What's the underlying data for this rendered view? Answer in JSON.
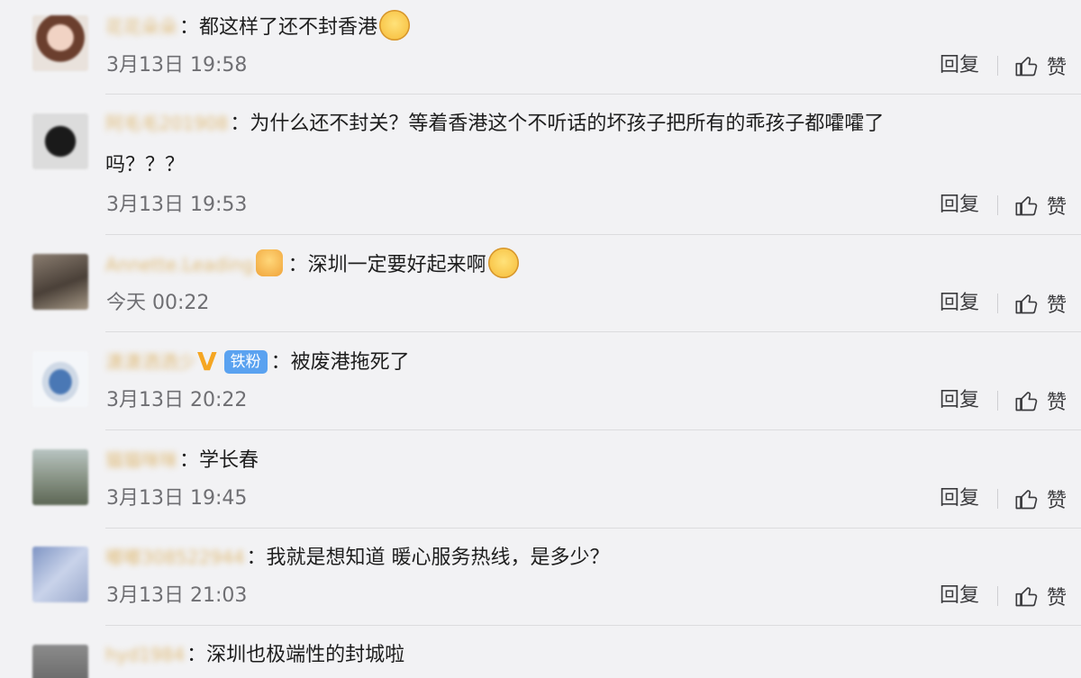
{
  "comments": [
    {
      "username": "花花朵朵",
      "text": "：都这样了还不封香港",
      "time": "3月13日 19:58",
      "reply": "回复",
      "like": "赞"
    },
    {
      "username": "阿毛毛201908",
      "text": "：为什么还不封关？等着香港这个不听话的坏孩子把所有的乖孩子都嚯嚯了",
      "text2": "吗？？？",
      "time": "3月13日 19:53",
      "reply": "回复",
      "like": "赞"
    },
    {
      "username": "Annette.Leading",
      "text": "：深圳一定要好起来啊",
      "time": "今天 00:22",
      "reply": "回复",
      "like": "赞"
    },
    {
      "username": "潇潇洒洒少",
      "badge": "铁粉",
      "text": "：被废港拖死了",
      "time": "3月13日 20:22",
      "reply": "回复",
      "like": "赞"
    },
    {
      "username": "猫猫咪咪",
      "text": "：学长春",
      "time": "3月13日 19:45",
      "reply": "回复",
      "like": "赞"
    },
    {
      "username": "嘟嘟308522944",
      "text": "：我就是想知道 暖心服务热线，是多少？",
      "time": "3月13日 21:03",
      "reply": "回复",
      "like": "赞"
    },
    {
      "username": "hyd1984",
      "text": "：深圳也极端性的封城啦"
    }
  ]
}
